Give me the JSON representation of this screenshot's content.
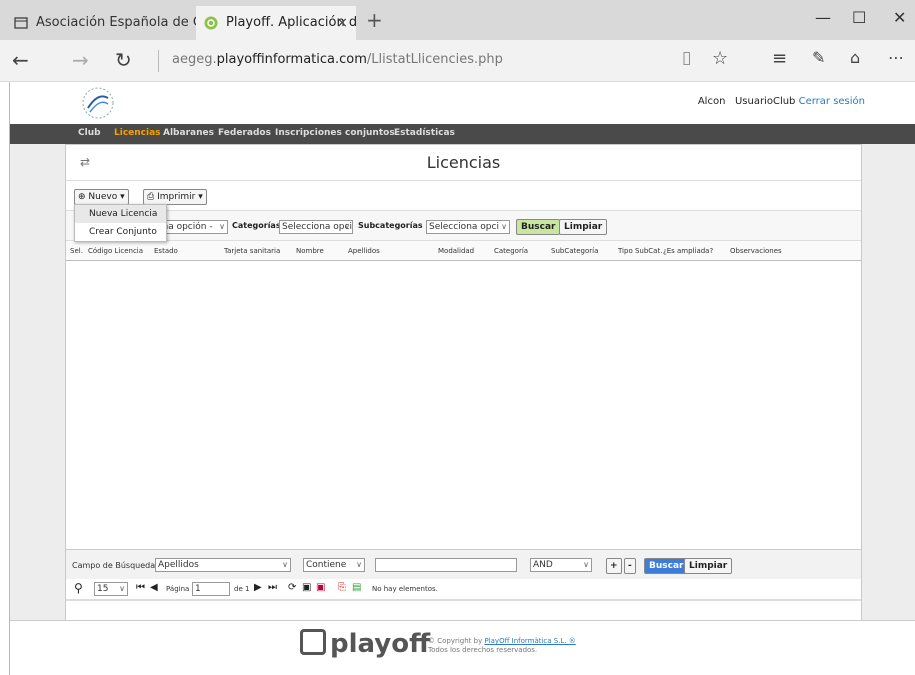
{
  "browser": {
    "tab1_title": "Asociación Española de Gimr",
    "tab2_title": "Playoff. Aplicación de lic",
    "tab_close": "×",
    "new_tab": "+",
    "url_host": "aegeg.",
    "url_domain": "playoffinformatica.com",
    "url_path": "/LlistatLlicencies.php"
  },
  "header": {
    "user_name": "Alcon",
    "user_role": "UsuarioClub",
    "logout": "Cerrar sesión"
  },
  "menu": [
    {
      "label": "Club"
    },
    {
      "label": "Licencias"
    },
    {
      "label": "Albaranes"
    },
    {
      "label": "Federados"
    },
    {
      "label": "Inscripciones conjuntos"
    },
    {
      "label": "Estadísticas"
    }
  ],
  "page": {
    "title": "Licencias",
    "new_button": "Nuevo",
    "print_button": "Imprimir",
    "dropdown": [
      "Nueva Licencia",
      "Crear Conjunto"
    ]
  },
  "filters": {
    "select1": "ona opción -",
    "categorias_label": "Categorías",
    "categorias_value": "Selecciona opci",
    "subcategorias_label": "Subcategorías",
    "subcategorias_value": "Selecciona opci",
    "buscar": "Buscar",
    "limpiar": "Limpiar"
  },
  "grid": {
    "columns": [
      "Sel.",
      "Código Licencia",
      "Estado",
      "Tarjeta sanitaria",
      "Nombre",
      "Apellidos",
      "Modalidad",
      "Categoría",
      "SubCategoría",
      "Tipo SubCat.",
      "¿Es ampliada?",
      "Observaciones"
    ]
  },
  "search": {
    "label": "Campo de Búsqueda",
    "field": "Apellidos",
    "operator": "Contiene",
    "value": "",
    "logic": "AND",
    "plus": "+",
    "minus": "-",
    "buscar": "Buscar",
    "limpiar": "Limpiar"
  },
  "pager": {
    "page_size": "15",
    "page_label": "Página",
    "page_value": "1",
    "of_label": "de 1",
    "status": "No hay elementos."
  },
  "footer": {
    "logo_text": "playoff",
    "copyright_prefix": "© Copyright by ",
    "copyright_link": "PlayOff Informàtica S.L. ®",
    "rights": "Todos los derechos reservados."
  },
  "colors": {
    "accent_orange": "#f4a100",
    "buscar_green": "#c8e6a0",
    "buscar_blue": "#3b7dd8",
    "menu_bg": "#4a4a4a"
  }
}
